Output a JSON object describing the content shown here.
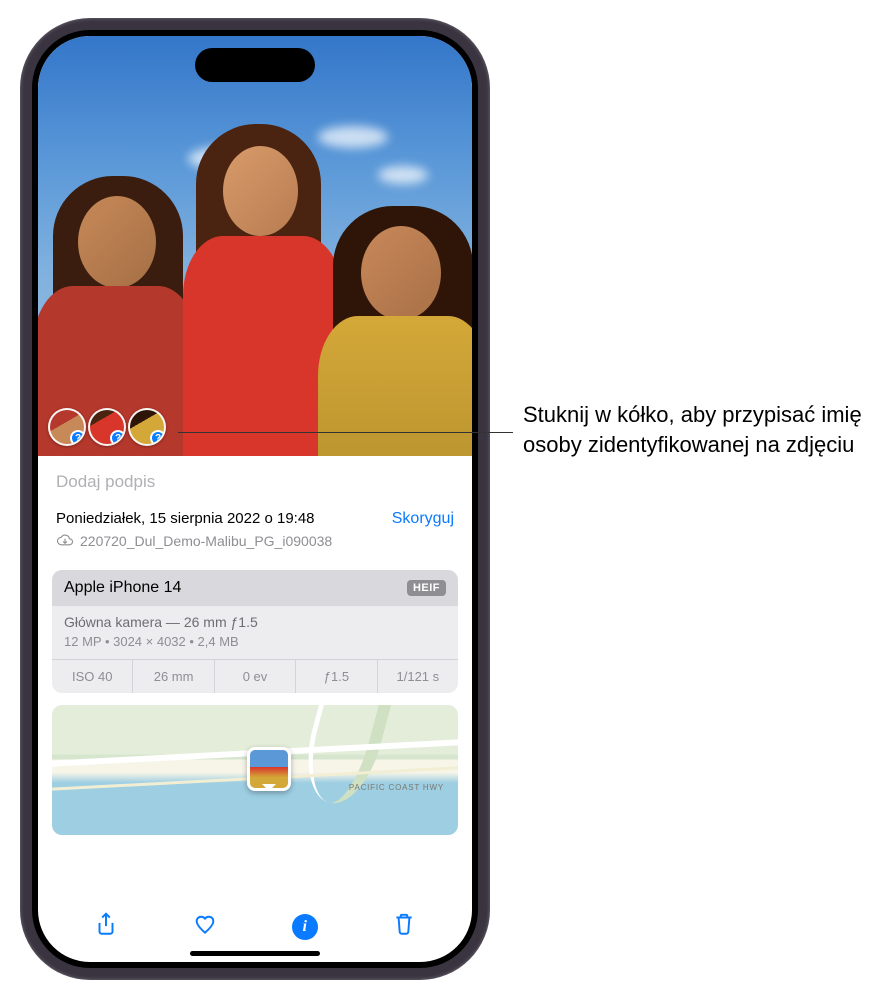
{
  "caption_placeholder": "Dodaj podpis",
  "date_line": "Poniedziałek, 15 sierpnia 2022 o 19:48",
  "adjust_label": "Skoryguj",
  "filename": "220720_Dul_Demo-Malibu_PG_i090038",
  "device": "Apple iPhone 14",
  "format_badge": "HEIF",
  "lens_line": "Główna kamera — 26 mm ƒ1.5",
  "specs_line": "12 MP  •  3024 × 4032  •  2,4 MB",
  "exif": {
    "iso": "ISO 40",
    "focal": "26 mm",
    "ev": "0 ev",
    "aperture": "ƒ1.5",
    "shutter": "1/121 s"
  },
  "map_road_label": "PACIFIC COAST HWY",
  "face_badge": "?",
  "callout": "Stuknij w kółko, aby przypisać imię osoby zidentyfikowanej na zdjęciu"
}
